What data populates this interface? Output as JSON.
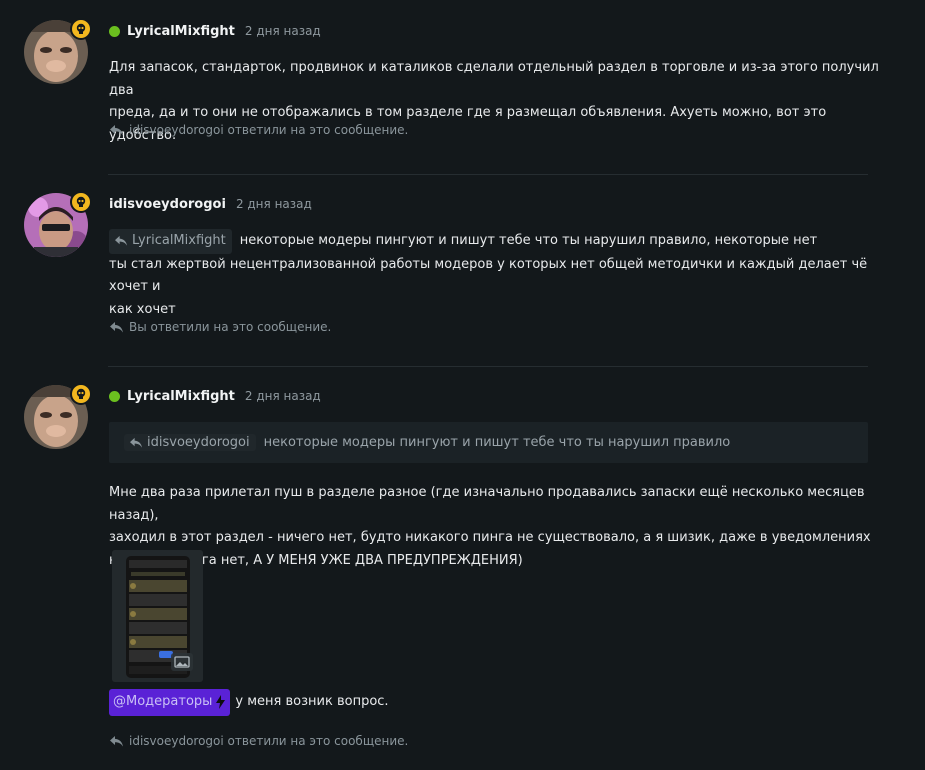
{
  "posts": [
    {
      "author": "LyricalMixfight",
      "time": "2 дня назад",
      "online": true,
      "lines": [
        "Для запасок, стандарток, продвинок и каталиков сделали отдельный раздел в торговле и из-за этого получил два",
        "преда, да и то они не отображались в том разделе где я размещал объявления. Ахуеть можно, вот это удобство."
      ],
      "replied": "idisvoeydorogoi ответили на это сообщение."
    },
    {
      "author": "idisvoeydorogoi",
      "time": "2 дня назад",
      "online": false,
      "reply_chip": "LyricalMixfight",
      "first_line": "некоторые модеры пингуют и пишут тебе что ты нарушил правило, некоторые нет",
      "lines": [
        "ты стал жертвой нецентрализованной работы модеров у которых нет общей методички и каждый делает чё хочет и",
        "как хочет"
      ],
      "replied": "Вы ответили на это сообщение."
    },
    {
      "author": "LyricalMixfight",
      "time": "2 дня назад",
      "online": true,
      "quote_author": "idisvoeydorogoi",
      "quote_text": "некоторые модеры пингуют и пишут тебе что ты нарушил правило",
      "lines": [
        "Мне два раза прилетал пуш в разделе разное (где изначально продавались запаски ещё несколько месяцев назад),",
        "заходил в этот раздел - ничего нет, будто никакого пинга не существовало, а я шизик, даже в уведомлениях",
        "никакого пинга нет, А У МЕНЯ УЖЕ ДВА ПРЕДУПРЕЖДЕНИЯ)"
      ],
      "mention": "@Модераторы",
      "mention_text": "у меня возник вопрос.",
      "replied": "idisvoeydorogoi ответили на это сообщение."
    }
  ],
  "icons": {
    "badge": "skull-icon",
    "reply": "reply-arrow-icon",
    "mention": "lightning-icon",
    "image": "image-icon"
  },
  "colors": {
    "background": "#13181b",
    "online": "#6bbf1f",
    "badge": "#f2b71f",
    "mention": "#5a22d6"
  }
}
